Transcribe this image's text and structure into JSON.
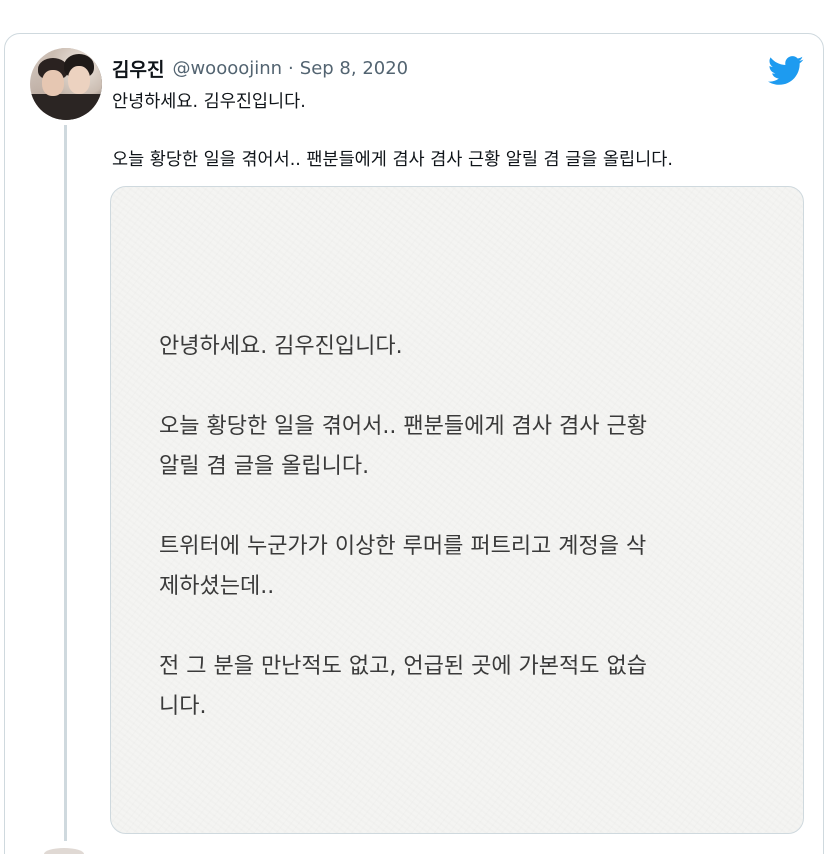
{
  "tweet": {
    "author_name": "김우진",
    "handle": "@woooojinn",
    "separator": "·",
    "date": "Sep 8, 2020",
    "text_line1": "안녕하세요. 김우진입니다.",
    "text_line2": "오늘 황당한 일을 겪어서.. 팬분들에게 겸사 겸사 근황 알릴 겸 글을 올립니다."
  },
  "media_note": {
    "paragraphs": [
      "안녕하세요. 김우진입니다.",
      "오늘 황당한 일을 겪어서.. 팬분들에게 겸사 겸사 근황\n알릴 겸 글을 올립니다.",
      "트위터에 누군가가 이상한 루머를 퍼트리고 계정을 삭\n제하셨는데..",
      "전 그 분을 만난적도 없고, 언급된 곳에 가본적도 없습\n니다."
    ]
  },
  "icons": {
    "brand": "twitter-bird-icon",
    "brand_color": "#1d9bf0"
  },
  "colors": {
    "text_primary": "#0f1419",
    "text_secondary": "#536471",
    "border": "#cfd9de"
  }
}
